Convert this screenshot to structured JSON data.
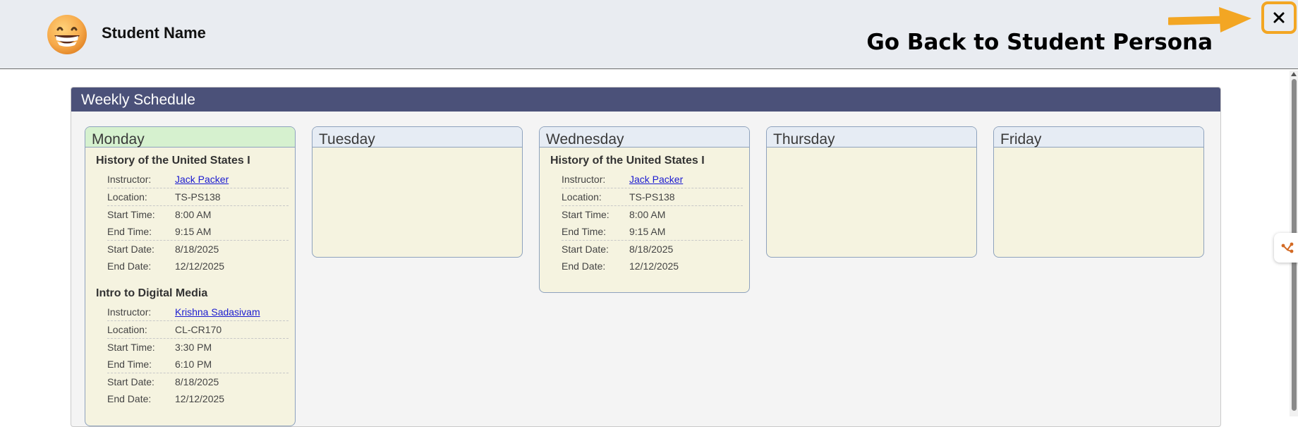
{
  "header": {
    "student_name": "Student Name",
    "go_back": "Go Back to Student Persona",
    "close_glyph": "✕",
    "accent_color": "#f3a623"
  },
  "schedule": {
    "title": "Weekly Schedule",
    "days": [
      {
        "name": "Monday",
        "today": true,
        "courses": [
          {
            "title": "History of the United States I",
            "instructor_label": "Instructor:",
            "instructor": "Jack Packer",
            "location_label": "Location:",
            "location": "TS-PS138",
            "start_time_label": "Start Time:",
            "start_time": "8:00 AM",
            "end_time_label": "End Time:",
            "end_time": "9:15 AM",
            "start_date_label": "Start Date:",
            "start_date": "8/18/2025",
            "end_date_label": "End Date:",
            "end_date": "12/12/2025"
          },
          {
            "title": "Intro to Digital Media",
            "instructor_label": "Instructor:",
            "instructor": "Krishna Sadasivam",
            "location_label": "Location:",
            "location": "CL-CR170",
            "start_time_label": "Start Time:",
            "start_time": "3:30 PM",
            "end_time_label": "End Time:",
            "end_time": "6:10 PM",
            "start_date_label": "Start Date:",
            "start_date": "8/18/2025",
            "end_date_label": "End Date:",
            "end_date": "12/12/2025"
          }
        ]
      },
      {
        "name": "Tuesday",
        "today": false,
        "courses": []
      },
      {
        "name": "Wednesday",
        "today": false,
        "courses": [
          {
            "title": "History of the United States I",
            "instructor_label": "Instructor:",
            "instructor": "Jack Packer",
            "location_label": "Location:",
            "location": "TS-PS138",
            "start_time_label": "Start Time:",
            "start_time": "8:00 AM",
            "end_time_label": "End Time:",
            "end_time": "9:15 AM",
            "start_date_label": "Start Date:",
            "start_date": "8/18/2025",
            "end_date_label": "End Date:",
            "end_date": "12/12/2025"
          }
        ]
      },
      {
        "name": "Thursday",
        "today": false,
        "courses": []
      },
      {
        "name": "Friday",
        "today": false,
        "courses": []
      }
    ]
  },
  "icons": {
    "avatar": "grinning-face-icon",
    "arrow": "arrow-right-icon",
    "close": "close-icon",
    "side_tab": "tool-icon"
  }
}
